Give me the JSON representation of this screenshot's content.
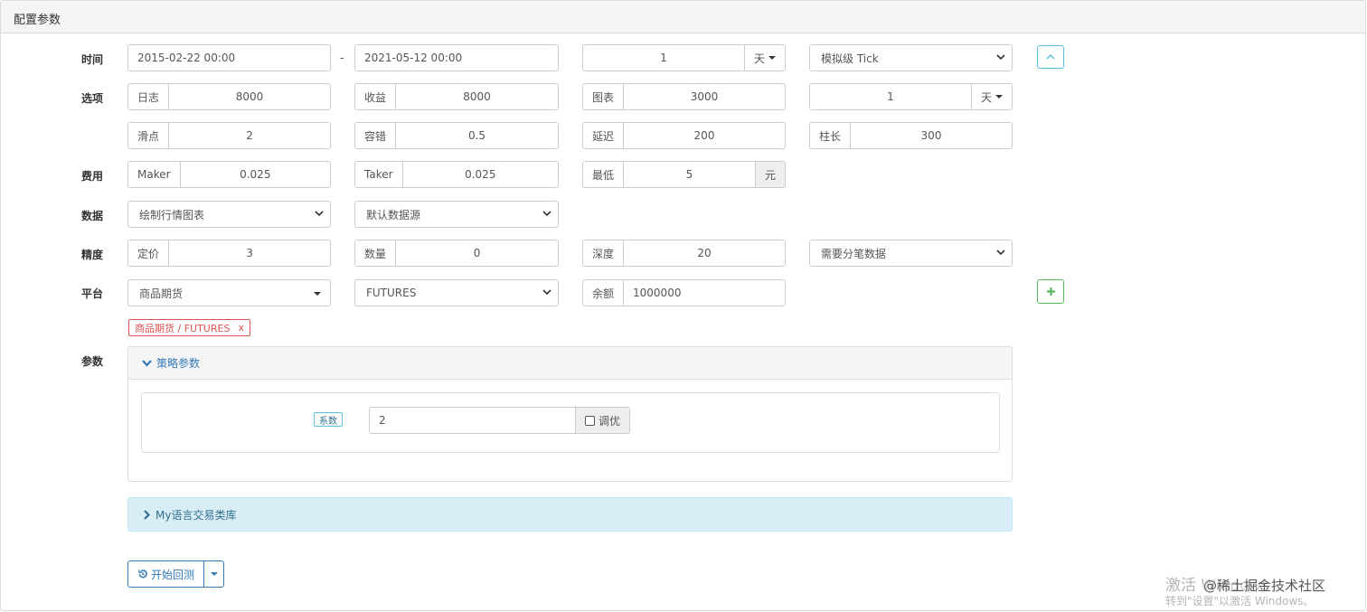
{
  "panel": {
    "title": "配置参数"
  },
  "time": {
    "label": "时间",
    "start": "2015-02-22 00:00",
    "separator": "-",
    "end": "2021-05-12 00:00",
    "period_value": "1",
    "period_unit": "天",
    "mode": "模拟级 Tick"
  },
  "options": {
    "label": "选项",
    "log_label": "日志",
    "log_value": "8000",
    "profit_label": "收益",
    "profit_value": "8000",
    "chart_label": "图表",
    "chart_value": "3000",
    "interval_value": "1",
    "interval_unit": "天",
    "slippage_label": "滑点",
    "slippage_value": "2",
    "tolerance_label": "容错",
    "tolerance_value": "0.5",
    "delay_label": "延迟",
    "delay_value": "200",
    "bar_label": "柱长",
    "bar_value": "300"
  },
  "fees": {
    "label": "费用",
    "maker_label": "Maker",
    "maker_value": "0.025",
    "taker_label": "Taker",
    "taker_value": "0.025",
    "min_label": "最低",
    "min_value": "5",
    "min_unit": "元"
  },
  "data": {
    "label": "数据",
    "chart_mode": "绘制行情图表",
    "source": "默认数据源"
  },
  "precision": {
    "label": "精度",
    "price_label": "定价",
    "price_value": "3",
    "amount_label": "数量",
    "amount_value": "0",
    "depth_label": "深度",
    "depth_value": "20",
    "tick_data": "需要分笔数据"
  },
  "platform": {
    "label": "平台",
    "exchange": "商品期货",
    "symbol": "FUTURES",
    "balance_label": "余额",
    "balance_value": "1000000",
    "tag_text": "商品期货 / FUTURES",
    "tag_close": "x"
  },
  "params": {
    "label": "参数",
    "section_title": "策略参数",
    "coef_label": "系数",
    "coef_value": "2",
    "optimize_label": "调优"
  },
  "library": {
    "title": "My语言交易类库"
  },
  "actions": {
    "start_label": "开始回测"
  },
  "watermark": {
    "line1": "激活 Windows",
    "line2": "转到\"设置\"以激活 Windows。",
    "brand": "@稀土掘金技术社区"
  },
  "colors": {
    "primary": "#337ab7",
    "success": "#5cb85c",
    "info": "#5bc0de",
    "danger": "#d9534f"
  }
}
